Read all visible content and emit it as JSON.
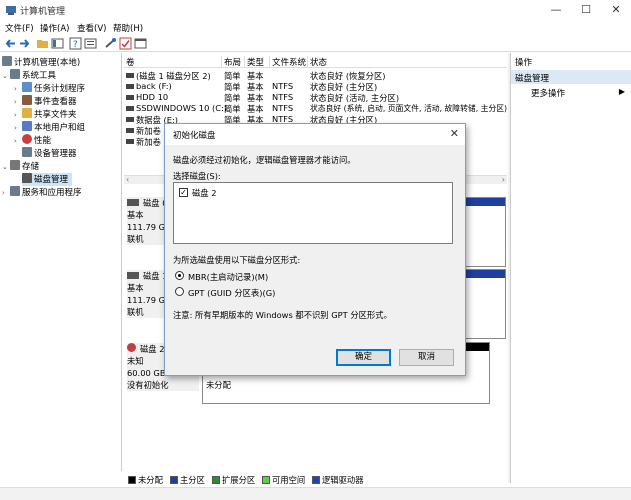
{
  "window": {
    "title": "计算机管理",
    "minimize": "—",
    "maximize": "☐",
    "close": "✕"
  },
  "menu": [
    "文件(F)",
    "操作(A)",
    "查看(V)",
    "帮助(H)"
  ],
  "tree": [
    {
      "label": "计算机管理(本地)",
      "exp": "",
      "color": "#6a7b8c"
    },
    {
      "label": "系统工具",
      "exp": "⌄",
      "color": "#6a7b8c"
    },
    {
      "label": "任务计划程序",
      "exp": "›",
      "color": "#5a8fc8"
    },
    {
      "label": "事件查看器",
      "exp": "›",
      "color": "#8a5a3c"
    },
    {
      "label": "共享文件夹",
      "exp": "›",
      "color": "#e0b040"
    },
    {
      "label": "本地用户和组",
      "exp": "›",
      "color": "#5a7ac8"
    },
    {
      "label": "性能",
      "exp": "›",
      "color": "#c84040"
    },
    {
      "label": "设备管理器",
      "exp": "",
      "color": "#6a7b8c"
    },
    {
      "label": "存储",
      "exp": "⌄",
      "color": "#777"
    },
    {
      "label": "磁盘管理",
      "exp": "",
      "color": "#555",
      "selected": true
    },
    {
      "label": "服务和应用程序",
      "exp": "›",
      "color": "#6a7b8c"
    }
  ],
  "volumes": {
    "headers": [
      "卷",
      "布局",
      "类型",
      "文件系统",
      "状态"
    ],
    "rows": [
      [
        "(磁盘 1 磁盘分区 2)",
        "简单",
        "基本",
        "",
        "状态良好 (恢复分区)"
      ],
      [
        "back (F:)",
        "简单",
        "基本",
        "NTFS",
        "状态良好 (主分区)"
      ],
      [
        "HDD 10",
        "简单",
        "基本",
        "NTFS",
        "状态良好 (活动, 主分区)"
      ],
      [
        "SSDWINDOWS 10 (C:)",
        "简单",
        "基本",
        "NTFS",
        "状态良好 (系统, 启动, 页面文件, 活动, 故障转储, 主分区)"
      ],
      [
        "数据盘 (E:)",
        "简单",
        "基本",
        "NTFS",
        "状态良好 (主分区)"
      ],
      [
        "新加卷",
        "简单",
        "基本",
        "",
        ""
      ],
      [
        "新加卷",
        "简单",
        "基本",
        "",
        ""
      ]
    ]
  },
  "disks": [
    {
      "name": "磁盘 0",
      "type": "基本",
      "size": "111.79 GB",
      "status": "联机"
    },
    {
      "name": "磁盘 1",
      "type": "基本",
      "size": "111.79 GB",
      "status": "联机"
    },
    {
      "name": "磁盘 2",
      "type": "未知",
      "size": "60.00 GB",
      "status": "没有初始化",
      "unalloc": "未分配"
    }
  ],
  "legend": [
    {
      "label": "未分配",
      "color": "#000000"
    },
    {
      "label": "主分区",
      "color": "#1f3f9e"
    },
    {
      "label": "扩展分区",
      "color": "#2e8b2e"
    },
    {
      "label": "可用空间",
      "color": "#59d44a"
    },
    {
      "label": "逻辑驱动器",
      "color": "#2040c0"
    }
  ],
  "actions": {
    "header": "操作",
    "section": "磁盘管理",
    "more": "更多操作"
  },
  "dialog": {
    "title": "初始化磁盘",
    "message": "磁盘必须经过初始化，逻辑磁盘管理器才能访问。",
    "select_label": "选择磁盘(S):",
    "disk_item": "磁盘 2",
    "style_label": "为所选磁盘使用以下磁盘分区形式:",
    "mbr": "MBR(主启动记录)(M)",
    "gpt": "GPT (GUID 分区表)(G)",
    "note": "注意: 所有早期版本的 Windows 都不识别 GPT 分区形式。",
    "ok": "确定",
    "cancel": "取消"
  }
}
